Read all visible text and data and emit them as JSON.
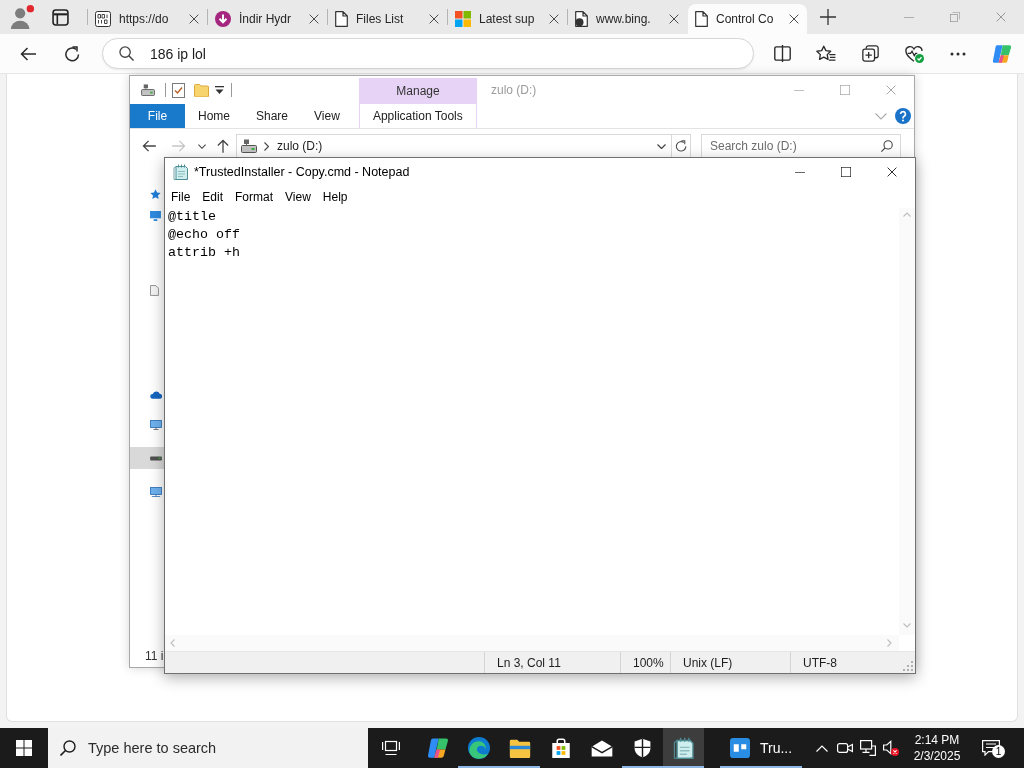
{
  "browser": {
    "tabs": [
      {
        "title": "https://do",
        "kind": "binary",
        "selected": false
      },
      {
        "title": "İndir Hydr",
        "kind": "download",
        "selected": false
      },
      {
        "title": "Files List",
        "kind": "page",
        "selected": false
      },
      {
        "title": "Latest sup",
        "kind": "squares",
        "selected": false
      },
      {
        "title": "www.bing.",
        "kind": "document",
        "selected": false
      },
      {
        "title": "Control Co",
        "kind": "page",
        "selected": true
      }
    ],
    "address_bar": {
      "value": "186 ip lol"
    }
  },
  "explorer": {
    "active": false,
    "context_header": "Manage",
    "title": "zulo (D:)",
    "ribbon_tabs": [
      {
        "label": "File",
        "kind": "file",
        "selected": false
      },
      {
        "label": "Home",
        "kind": "tab",
        "selected": false
      },
      {
        "label": "Share",
        "kind": "tab",
        "selected": false
      },
      {
        "label": "View",
        "kind": "tab",
        "selected": false
      },
      {
        "label": "Application Tools",
        "kind": "context",
        "selected": false
      }
    ],
    "forward_disabled": true,
    "address": "zulo (D:)",
    "search": {
      "placeholder": "Search zulo (D:)"
    },
    "nav_items": [
      {
        "kind": "quick-access",
        "selected": false
      },
      {
        "kind": "desktop",
        "selected": false
      },
      {
        "kind": "documents",
        "selected": false
      },
      {
        "kind": "cloud",
        "selected": false
      },
      {
        "kind": "pc",
        "selected": false
      },
      {
        "kind": "drive",
        "selected": true
      },
      {
        "kind": "network",
        "selected": false
      }
    ],
    "status": "11 i"
  },
  "notepad": {
    "active": true,
    "title": "*TrustedInstaller - Copy.cmd - Notepad",
    "menu": [
      "File",
      "Edit",
      "Format",
      "View",
      "Help"
    ],
    "text": "@title\n@echo off\nattrib +h",
    "status": {
      "position": "Ln 3, Col 11",
      "zoom": "100%",
      "line_endings": "Unix (LF)",
      "encoding": "UTF-8"
    }
  },
  "taskbar": {
    "search": {
      "placeholder": "Type here to search"
    },
    "apps": [
      {
        "kind": "task-view",
        "running": false,
        "selected": false
      },
      {
        "kind": "copilot",
        "running": false,
        "selected": false
      },
      {
        "kind": "browser",
        "running": true,
        "selected": false
      },
      {
        "kind": "folder",
        "running": true,
        "selected": false
      },
      {
        "kind": "store",
        "running": false,
        "selected": false
      },
      {
        "kind": "mail",
        "running": false,
        "selected": false
      },
      {
        "kind": "shield",
        "running": true,
        "selected": false
      },
      {
        "kind": "notepad",
        "running": true,
        "selected": true
      },
      {
        "kind": "window",
        "label": "Tru...",
        "running": true,
        "selected": false
      }
    ],
    "tray": [
      {
        "kind": "chevron"
      },
      {
        "kind": "camera"
      },
      {
        "kind": "network"
      },
      {
        "kind": "muted-speaker"
      }
    ],
    "clock": {
      "time": "2:14 PM",
      "date": "2/3/2025"
    },
    "notifications": {
      "count": "1"
    }
  }
}
